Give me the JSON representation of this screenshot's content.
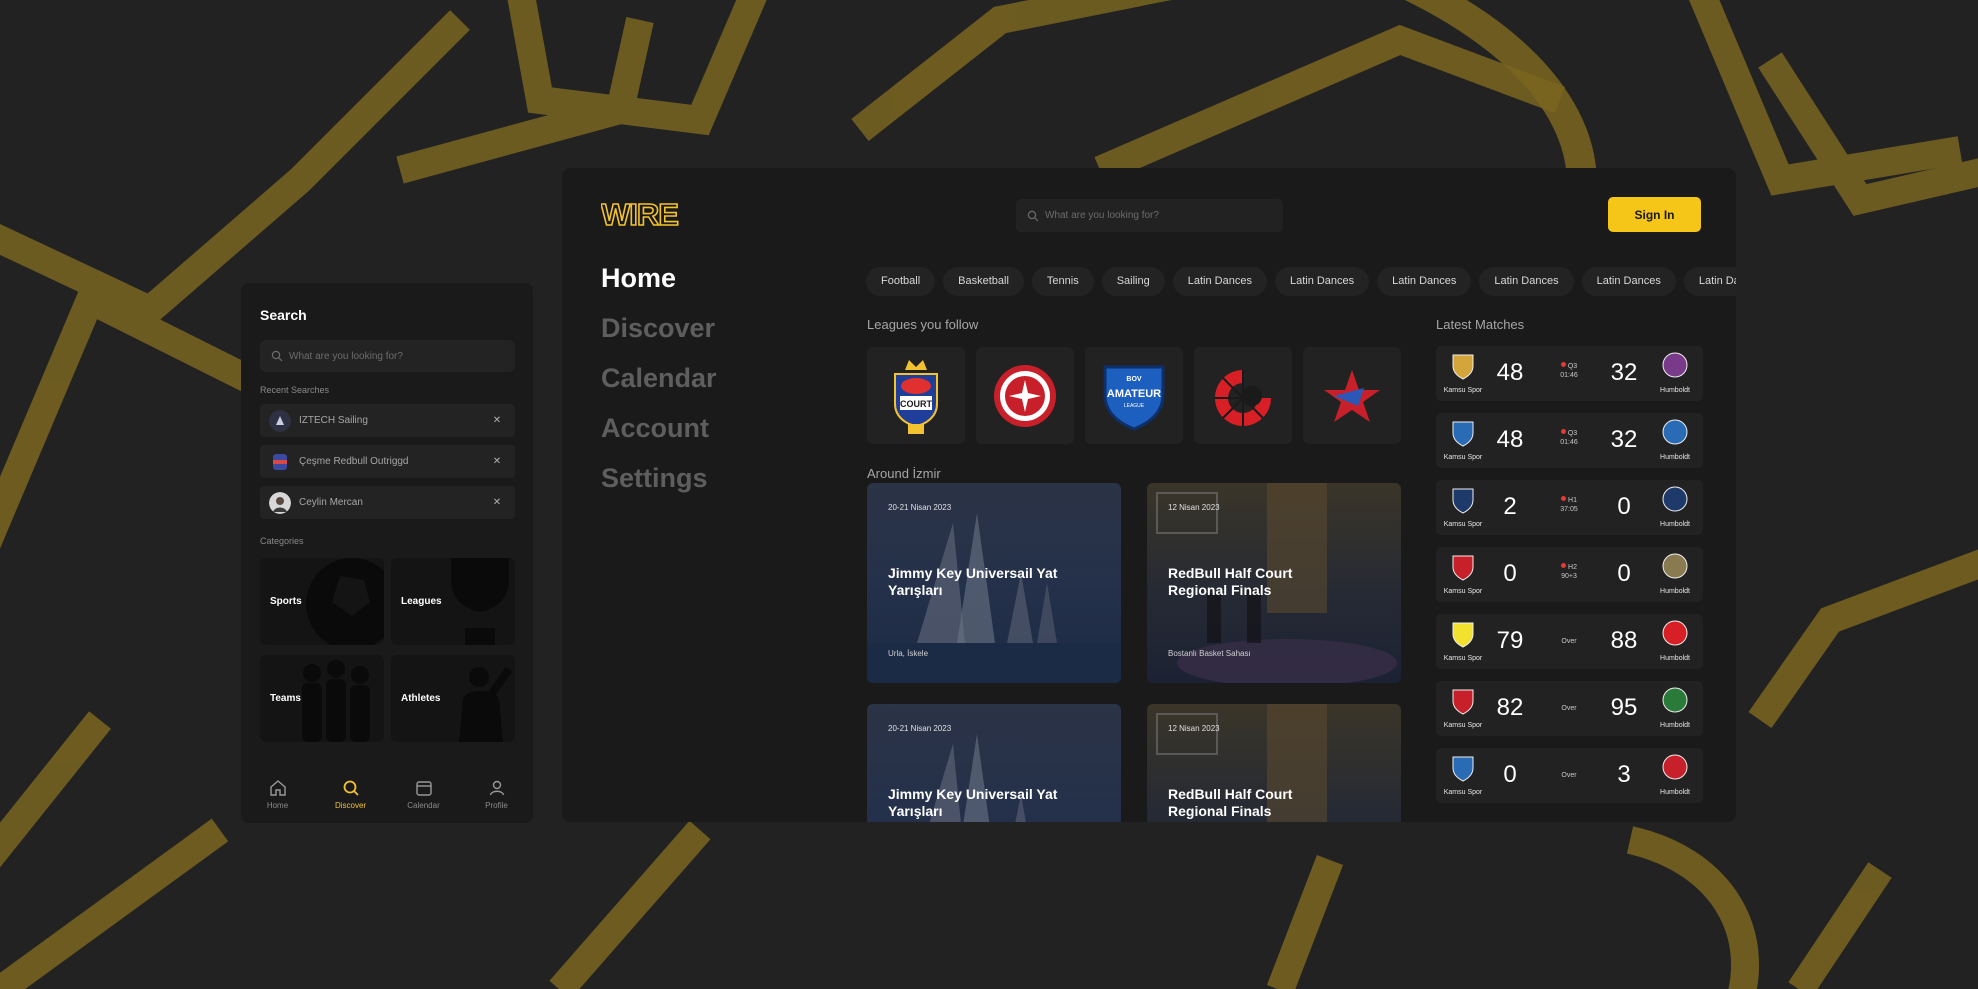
{
  "mobile": {
    "title": "Search",
    "search_placeholder": "What are you looking for?",
    "recent_label": "Recent Searches",
    "recent": [
      {
        "label": "IZTECH Sailing"
      },
      {
        "label": "Çeşme Redbull Outriggd"
      },
      {
        "label": "Ceylin Mercan"
      }
    ],
    "categories_label": "Categories",
    "categories": [
      {
        "label": "Sports"
      },
      {
        "label": "Leagues"
      },
      {
        "label": "Teams"
      },
      {
        "label": "Athletes"
      }
    ],
    "tabbar": [
      {
        "label": "Home",
        "icon": "home-icon"
      },
      {
        "label": "Discover",
        "icon": "search-icon",
        "active": true
      },
      {
        "label": "Calendar",
        "icon": "calendar-icon"
      },
      {
        "label": "Profile",
        "icon": "profile-icon"
      }
    ]
  },
  "desktop": {
    "brand": "WIRE",
    "search_placeholder": "What are you looking for?",
    "signin_label": "Sign In",
    "nav": [
      {
        "label": "Home",
        "active": true
      },
      {
        "label": "Discover"
      },
      {
        "label": "Calendar"
      },
      {
        "label": "Account"
      },
      {
        "label": "Settings"
      }
    ],
    "chips": [
      "Football",
      "Basketball",
      "Tennis",
      "Sailing",
      "Latin Dances",
      "Latin Dances",
      "Latin Dances",
      "Latin Dances",
      "Latin Dances",
      "Latin Dances"
    ],
    "leagues_title": "Leagues you follow",
    "leagues": [
      {
        "name": "Red Bull Half Court",
        "icon": "redbull-half-court-logo"
      },
      {
        "name": "",
        "icon": "red-seal-logo"
      },
      {
        "name": "BOV Amateur League",
        "icon": "amateur-league-logo",
        "text": "AMATEUR",
        "top": "BOV",
        "bottom": "LEAGUE"
      },
      {
        "name": "",
        "icon": "red-swirl-logo"
      },
      {
        "name": "",
        "icon": "star-logo"
      }
    ],
    "around_title": "Around İzmir",
    "events": [
      {
        "date": "20-21 Nisan 2023",
        "name": "Jimmy Key Universail Yat Yarışları",
        "place": "Urla, İskele"
      },
      {
        "date": "12 Nisan 2023",
        "name": "RedBull Half Court Regional Finals",
        "place": "Bostanlı Basket Sahası"
      },
      {
        "date": "20-21 Nisan 2023",
        "name": "Jimmy Key Universail Yat Yarışları",
        "place": ""
      },
      {
        "date": "12 Nisan 2023",
        "name": "RedBull Half Court Regional Finals",
        "place": ""
      }
    ],
    "matches_title": "Latest Matches",
    "matches": [
      {
        "home": "Kamsu Spor",
        "away": "Humboldt",
        "hs": "48",
        "as": "32",
        "status1": "Q3",
        "status2": "01:46",
        "live": true
      },
      {
        "home": "Kamsu Spor",
        "away": "Humboldt",
        "hs": "48",
        "as": "32",
        "status1": "Q3",
        "status2": "01:46",
        "live": true
      },
      {
        "home": "Kamsu Spor",
        "away": "Humboldt",
        "hs": "2",
        "as": "0",
        "status1": "H1",
        "status2": "37:05",
        "live": true
      },
      {
        "home": "Kamsu Spor",
        "away": "Humboldt",
        "hs": "0",
        "as": "0",
        "status1": "H2",
        "status2": "90+3",
        "live": true
      },
      {
        "home": "Kamsu Spor",
        "away": "Humboldt",
        "hs": "79",
        "as": "88",
        "status1": "Over",
        "status2": "",
        "live": false
      },
      {
        "home": "Kamsu Spor",
        "away": "Humboldt",
        "hs": "82",
        "as": "95",
        "status1": "Over",
        "status2": "",
        "live": false
      },
      {
        "home": "Kamsu Spor",
        "away": "Humboldt",
        "hs": "0",
        "as": "3",
        "status1": "Over",
        "status2": "",
        "live": false
      }
    ]
  },
  "colors": {
    "accent": "#f5c518",
    "background": "#222222",
    "panel": "#1a1a1a",
    "card": "#232323"
  }
}
